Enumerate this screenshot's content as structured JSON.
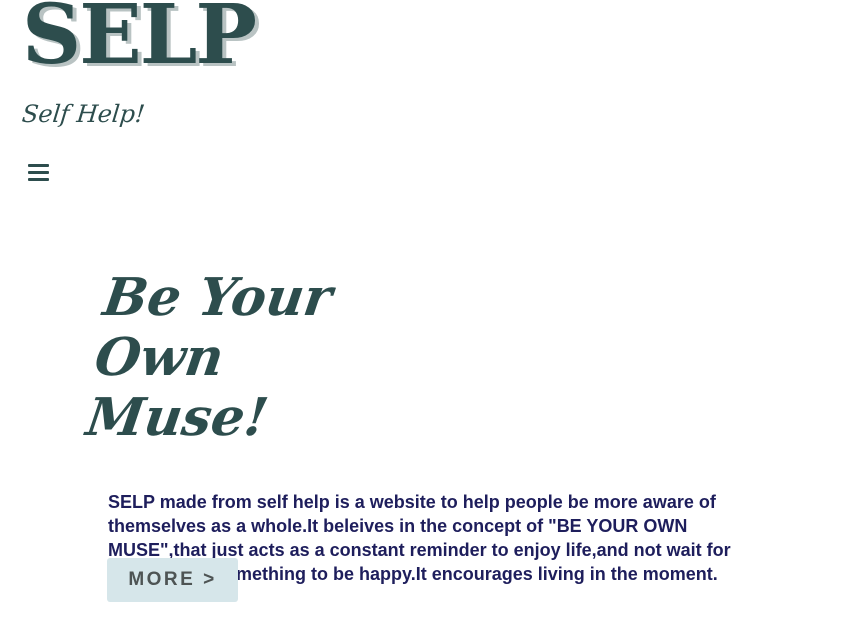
{
  "header": {
    "logo": "SELP",
    "tagline": "Self Help!",
    "menu_icon": "hamburger-menu-icon"
  },
  "hero": {
    "headline_line1": "Be Your",
    "headline_line2": "Own Muse!",
    "intro": {
      "part1": "SELP",
      "part2": " made from self help is a website to help people be more aware of themselves as a whole.It beleives in the concept of \"",
      "part3": "BE YOUR OWN MUSE",
      "part4": "\",that just acts as a constant reminder to enjoy life,and not wait for someone or something to be happy.It encourages living in the moment."
    },
    "more_label": "MORE >"
  },
  "colors": {
    "brand": "#2d4d4d",
    "logo_shadow": "#b9c3c3",
    "body_text": "#1e1e5c",
    "button_bg": "#d6e6ea",
    "button_text": "#4e5454",
    "background": "#ffffff"
  }
}
